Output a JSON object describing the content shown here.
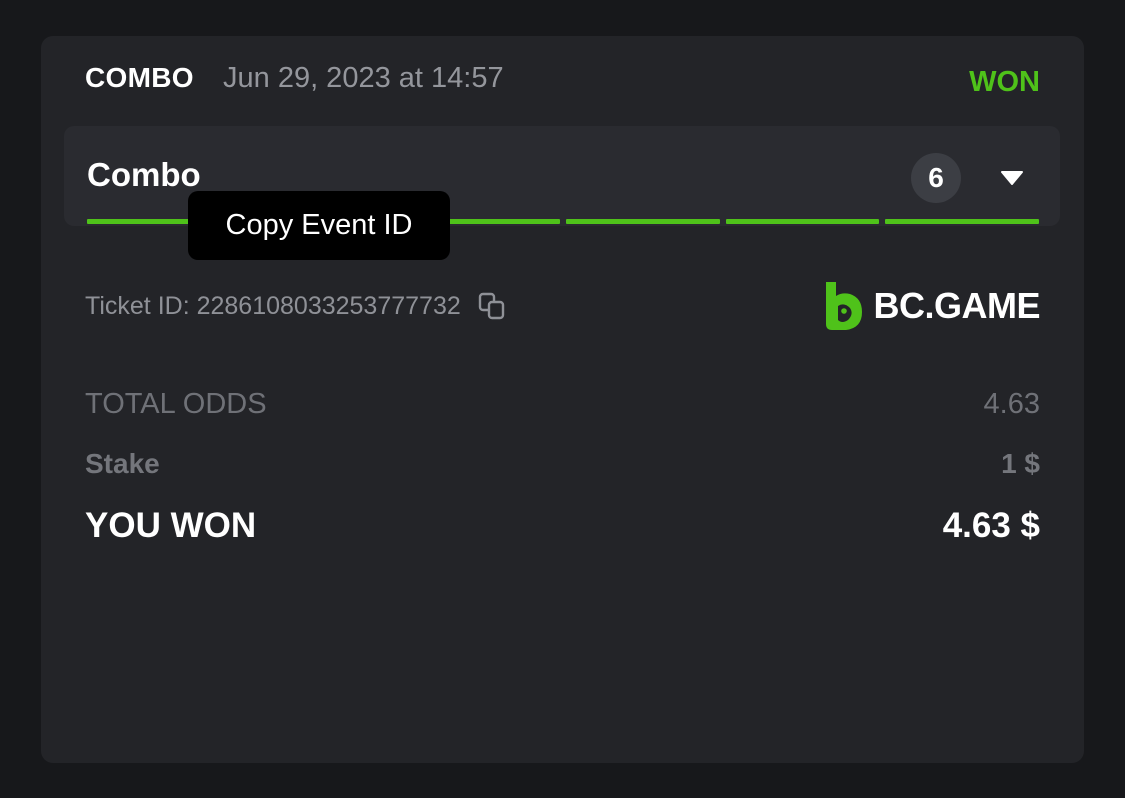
{
  "header": {
    "bet_type": "COMBO",
    "date": "Jun 29, 2023 at 14:57",
    "status": "WON"
  },
  "combo": {
    "title": "Combo",
    "count": "6",
    "legs": [
      "won",
      "won",
      "won",
      "won",
      "won",
      "won"
    ],
    "tooltip": "Copy Event ID"
  },
  "ticket": {
    "label": "Ticket ID: 2286108033253777732"
  },
  "logo": {
    "text": "BC.GAME"
  },
  "summary": {
    "total_odds_label": "TOTAL ODDS",
    "total_odds_value": "4.63",
    "stake_label": "Stake",
    "stake_value": "1 $",
    "won_label": "YOU WON",
    "won_value": "4.63 $"
  },
  "colors": {
    "accent_green": "#4fc21a",
    "card_bg": "#232428",
    "page_bg": "#17181b"
  },
  "icons": {
    "expand": "chevron-down-icon",
    "copy": "copy-icon",
    "logo": "bc-game-logo-icon"
  }
}
